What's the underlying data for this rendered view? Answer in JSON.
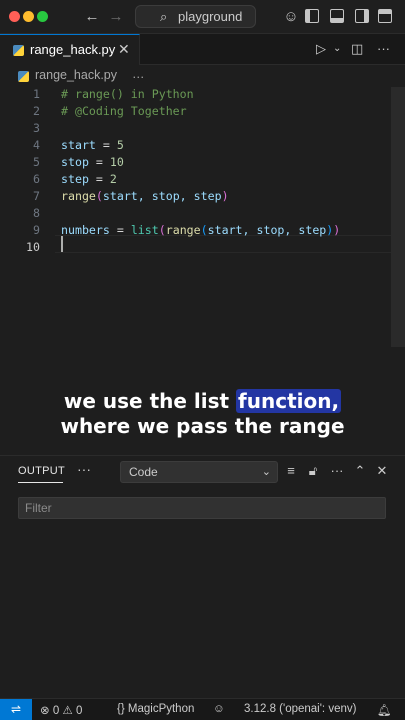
{
  "window": {
    "search_text": "playground"
  },
  "tab": {
    "title": "range_hack.py",
    "close": "✕"
  },
  "breadcrumb": {
    "file": "range_hack.py",
    "more": "…"
  },
  "editor": {
    "line_numbers": [
      "1",
      "2",
      "3",
      "4",
      "5",
      "6",
      "7",
      "8",
      "9",
      "10"
    ],
    "active_line": "10",
    "lines": {
      "l1": "# range() in Python",
      "l2": "# @Coding Together",
      "l4_var": "start",
      "l4_op": " = ",
      "l4_val": "5",
      "l5_var": "stop",
      "l5_op": " = ",
      "l5_val": "10",
      "l6_var": "step",
      "l6_op": " = ",
      "l6_val": "2",
      "l7_func": "range",
      "l7_open": "(",
      "l7_args": "start, stop, step",
      "l7_close": ")",
      "l9_var": "numbers",
      "l9_op": " = ",
      "l9_list": "list",
      "l9_open": "(",
      "l9_range": "range",
      "l9_open2": "(",
      "l9_args": "start, stop, step",
      "l9_close2": ")",
      "l9_close": ")"
    }
  },
  "subtitles": {
    "line1_pre": "we use the list ",
    "line1_highlight": "function,",
    "line2": "where we pass the range"
  },
  "panel": {
    "tab_label": "OUTPUT",
    "more": "···",
    "select_value": "Code",
    "filter_placeholder": "Filter"
  },
  "statusbar": {
    "errors": "0",
    "warnings": "0",
    "language_server": "MagicPython",
    "interpreter": "3.12.8 ('openai': venv)"
  },
  "colors": {
    "accent": "#0078d4",
    "highlight": "#2336a3"
  }
}
